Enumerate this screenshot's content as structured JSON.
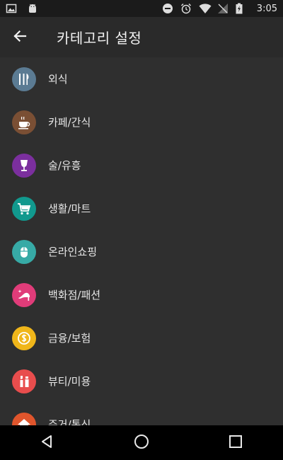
{
  "status_bar": {
    "time": "3:05",
    "icons": [
      "image-icon",
      "android-icon",
      "do-not-disturb-icon",
      "alarm-icon",
      "wifi-icon",
      "no-signal-icon",
      "battery-charging-icon"
    ]
  },
  "header": {
    "title": "카테고리 설정",
    "back_icon": "arrow-back-icon"
  },
  "categories": [
    {
      "label": "외식",
      "icon": "fork-knife-icon",
      "color": "#5b7b93"
    },
    {
      "label": "카페/간식",
      "icon": "coffee-cup-icon",
      "color": "#7a4f34"
    },
    {
      "label": "술/유흥",
      "icon": "wine-glass-icon",
      "color": "#7b2f9e"
    },
    {
      "label": "생활/마트",
      "icon": "shopping-cart-icon",
      "color": "#11998e"
    },
    {
      "label": "온라인쇼핑",
      "icon": "mouse-icon",
      "color": "#37aaa6"
    },
    {
      "label": "백화점/패션",
      "icon": "high-heel-icon",
      "color": "#e03c79"
    },
    {
      "label": "금융/보험",
      "icon": "dollar-coin-icon",
      "color": "#f0b61a"
    },
    {
      "label": "뷰티/미용",
      "icon": "lipstick-icon",
      "color": "#e84d4d"
    },
    {
      "label": "주거/통신",
      "icon": "house-icon",
      "color": "#e0552c"
    }
  ],
  "nav": {
    "buttons": [
      "back-triangle-icon",
      "home-circle-icon",
      "recents-square-icon"
    ]
  }
}
